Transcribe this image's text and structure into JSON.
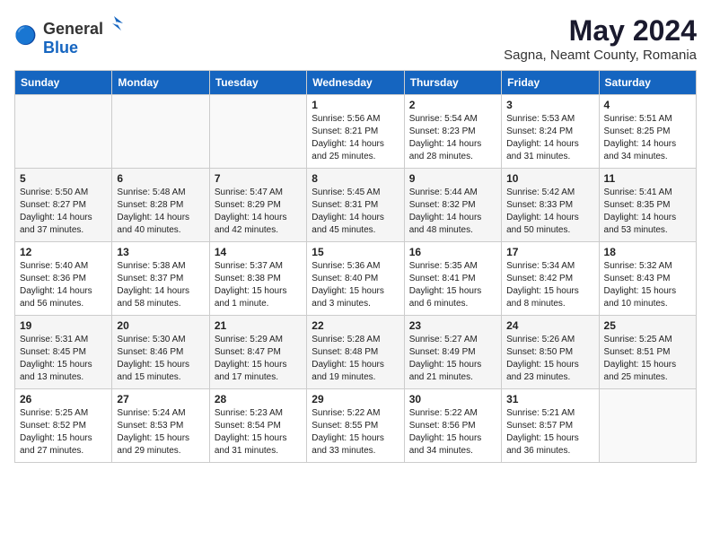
{
  "logo": {
    "general": "General",
    "blue": "Blue"
  },
  "title": "May 2024",
  "location": "Sagna, Neamt County, Romania",
  "days_of_week": [
    "Sunday",
    "Monday",
    "Tuesday",
    "Wednesday",
    "Thursday",
    "Friday",
    "Saturday"
  ],
  "weeks": [
    [
      {
        "day": "",
        "info": ""
      },
      {
        "day": "",
        "info": ""
      },
      {
        "day": "",
        "info": ""
      },
      {
        "day": "1",
        "info": "Sunrise: 5:56 AM\nSunset: 8:21 PM\nDaylight: 14 hours\nand 25 minutes."
      },
      {
        "day": "2",
        "info": "Sunrise: 5:54 AM\nSunset: 8:23 PM\nDaylight: 14 hours\nand 28 minutes."
      },
      {
        "day": "3",
        "info": "Sunrise: 5:53 AM\nSunset: 8:24 PM\nDaylight: 14 hours\nand 31 minutes."
      },
      {
        "day": "4",
        "info": "Sunrise: 5:51 AM\nSunset: 8:25 PM\nDaylight: 14 hours\nand 34 minutes."
      }
    ],
    [
      {
        "day": "5",
        "info": "Sunrise: 5:50 AM\nSunset: 8:27 PM\nDaylight: 14 hours\nand 37 minutes."
      },
      {
        "day": "6",
        "info": "Sunrise: 5:48 AM\nSunset: 8:28 PM\nDaylight: 14 hours\nand 40 minutes."
      },
      {
        "day": "7",
        "info": "Sunrise: 5:47 AM\nSunset: 8:29 PM\nDaylight: 14 hours\nand 42 minutes."
      },
      {
        "day": "8",
        "info": "Sunrise: 5:45 AM\nSunset: 8:31 PM\nDaylight: 14 hours\nand 45 minutes."
      },
      {
        "day": "9",
        "info": "Sunrise: 5:44 AM\nSunset: 8:32 PM\nDaylight: 14 hours\nand 48 minutes."
      },
      {
        "day": "10",
        "info": "Sunrise: 5:42 AM\nSunset: 8:33 PM\nDaylight: 14 hours\nand 50 minutes."
      },
      {
        "day": "11",
        "info": "Sunrise: 5:41 AM\nSunset: 8:35 PM\nDaylight: 14 hours\nand 53 minutes."
      }
    ],
    [
      {
        "day": "12",
        "info": "Sunrise: 5:40 AM\nSunset: 8:36 PM\nDaylight: 14 hours\nand 56 minutes."
      },
      {
        "day": "13",
        "info": "Sunrise: 5:38 AM\nSunset: 8:37 PM\nDaylight: 14 hours\nand 58 minutes."
      },
      {
        "day": "14",
        "info": "Sunrise: 5:37 AM\nSunset: 8:38 PM\nDaylight: 15 hours\nand 1 minute."
      },
      {
        "day": "15",
        "info": "Sunrise: 5:36 AM\nSunset: 8:40 PM\nDaylight: 15 hours\nand 3 minutes."
      },
      {
        "day": "16",
        "info": "Sunrise: 5:35 AM\nSunset: 8:41 PM\nDaylight: 15 hours\nand 6 minutes."
      },
      {
        "day": "17",
        "info": "Sunrise: 5:34 AM\nSunset: 8:42 PM\nDaylight: 15 hours\nand 8 minutes."
      },
      {
        "day": "18",
        "info": "Sunrise: 5:32 AM\nSunset: 8:43 PM\nDaylight: 15 hours\nand 10 minutes."
      }
    ],
    [
      {
        "day": "19",
        "info": "Sunrise: 5:31 AM\nSunset: 8:45 PM\nDaylight: 15 hours\nand 13 minutes."
      },
      {
        "day": "20",
        "info": "Sunrise: 5:30 AM\nSunset: 8:46 PM\nDaylight: 15 hours\nand 15 minutes."
      },
      {
        "day": "21",
        "info": "Sunrise: 5:29 AM\nSunset: 8:47 PM\nDaylight: 15 hours\nand 17 minutes."
      },
      {
        "day": "22",
        "info": "Sunrise: 5:28 AM\nSunset: 8:48 PM\nDaylight: 15 hours\nand 19 minutes."
      },
      {
        "day": "23",
        "info": "Sunrise: 5:27 AM\nSunset: 8:49 PM\nDaylight: 15 hours\nand 21 minutes."
      },
      {
        "day": "24",
        "info": "Sunrise: 5:26 AM\nSunset: 8:50 PM\nDaylight: 15 hours\nand 23 minutes."
      },
      {
        "day": "25",
        "info": "Sunrise: 5:25 AM\nSunset: 8:51 PM\nDaylight: 15 hours\nand 25 minutes."
      }
    ],
    [
      {
        "day": "26",
        "info": "Sunrise: 5:25 AM\nSunset: 8:52 PM\nDaylight: 15 hours\nand 27 minutes."
      },
      {
        "day": "27",
        "info": "Sunrise: 5:24 AM\nSunset: 8:53 PM\nDaylight: 15 hours\nand 29 minutes."
      },
      {
        "day": "28",
        "info": "Sunrise: 5:23 AM\nSunset: 8:54 PM\nDaylight: 15 hours\nand 31 minutes."
      },
      {
        "day": "29",
        "info": "Sunrise: 5:22 AM\nSunset: 8:55 PM\nDaylight: 15 hours\nand 33 minutes."
      },
      {
        "day": "30",
        "info": "Sunrise: 5:22 AM\nSunset: 8:56 PM\nDaylight: 15 hours\nand 34 minutes."
      },
      {
        "day": "31",
        "info": "Sunrise: 5:21 AM\nSunset: 8:57 PM\nDaylight: 15 hours\nand 36 minutes."
      },
      {
        "day": "",
        "info": ""
      }
    ]
  ]
}
